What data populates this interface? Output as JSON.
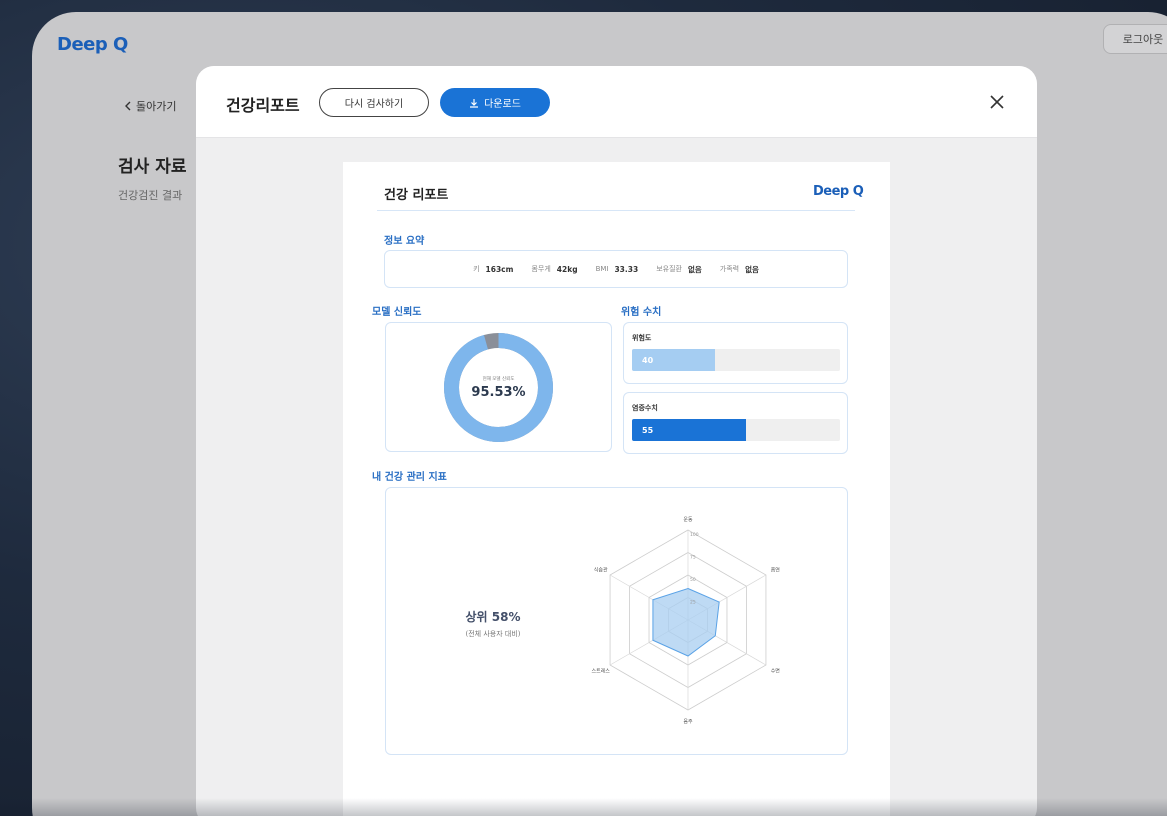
{
  "app": {
    "logo": "Deep Q",
    "logout_label": "로그아웃",
    "back_label": "돌아가기",
    "page_title": "검사 자료",
    "page_subtitle": "건강검진 결과"
  },
  "modal": {
    "title": "건강리포트",
    "retest_label": "다시 검사하기",
    "download_label": "다운로드"
  },
  "report": {
    "title": "건강 리포트",
    "logo": "Deep Q",
    "summary_section": "정보 요약",
    "summary": [
      {
        "label": "키",
        "value": "163cm"
      },
      {
        "label": "몸무게",
        "value": "42kg"
      },
      {
        "label": "BMI",
        "value": "33.33"
      },
      {
        "label": "보유질환",
        "value": "없음"
      },
      {
        "label": "가족력",
        "value": "없음"
      }
    ],
    "confidence_section": "모델 신뢰도",
    "confidence": {
      "caption": "현재 모델 신뢰도",
      "value": "95.53%",
      "fraction": 0.9553
    },
    "risk_section": "위험 수치",
    "risk": [
      {
        "label": "위험도",
        "value": "40",
        "fraction": 0.4,
        "color": "#a5cdf2"
      },
      {
        "label": "염증수치",
        "value": "55",
        "fraction": 0.55,
        "color": "#1a73d6"
      }
    ],
    "health_section": "내 건강 관리 지표",
    "rank": {
      "main": "상위 58%",
      "sub": "(전체 사용자 대비)"
    }
  },
  "chart_data": {
    "type": "radar",
    "axes": [
      "운동",
      "흡연",
      "수면",
      "음주",
      "스트레스",
      "식습관"
    ],
    "scale_labels": [
      "100",
      "75",
      "50",
      "25"
    ],
    "max": 100,
    "values": [
      35,
      40,
      35,
      40,
      45,
      45
    ],
    "fill_color": "#a8cdf0",
    "stroke_color": "#5aa2e6"
  },
  "colors": {
    "accent": "#1a73d6",
    "section_label": "#2a6fc4",
    "donut_main": "#7eb6ec",
    "donut_rest": "#8a8f99"
  },
  "icons": {
    "back": "chevron-left-icon",
    "download": "download-icon",
    "close": "close-icon"
  }
}
